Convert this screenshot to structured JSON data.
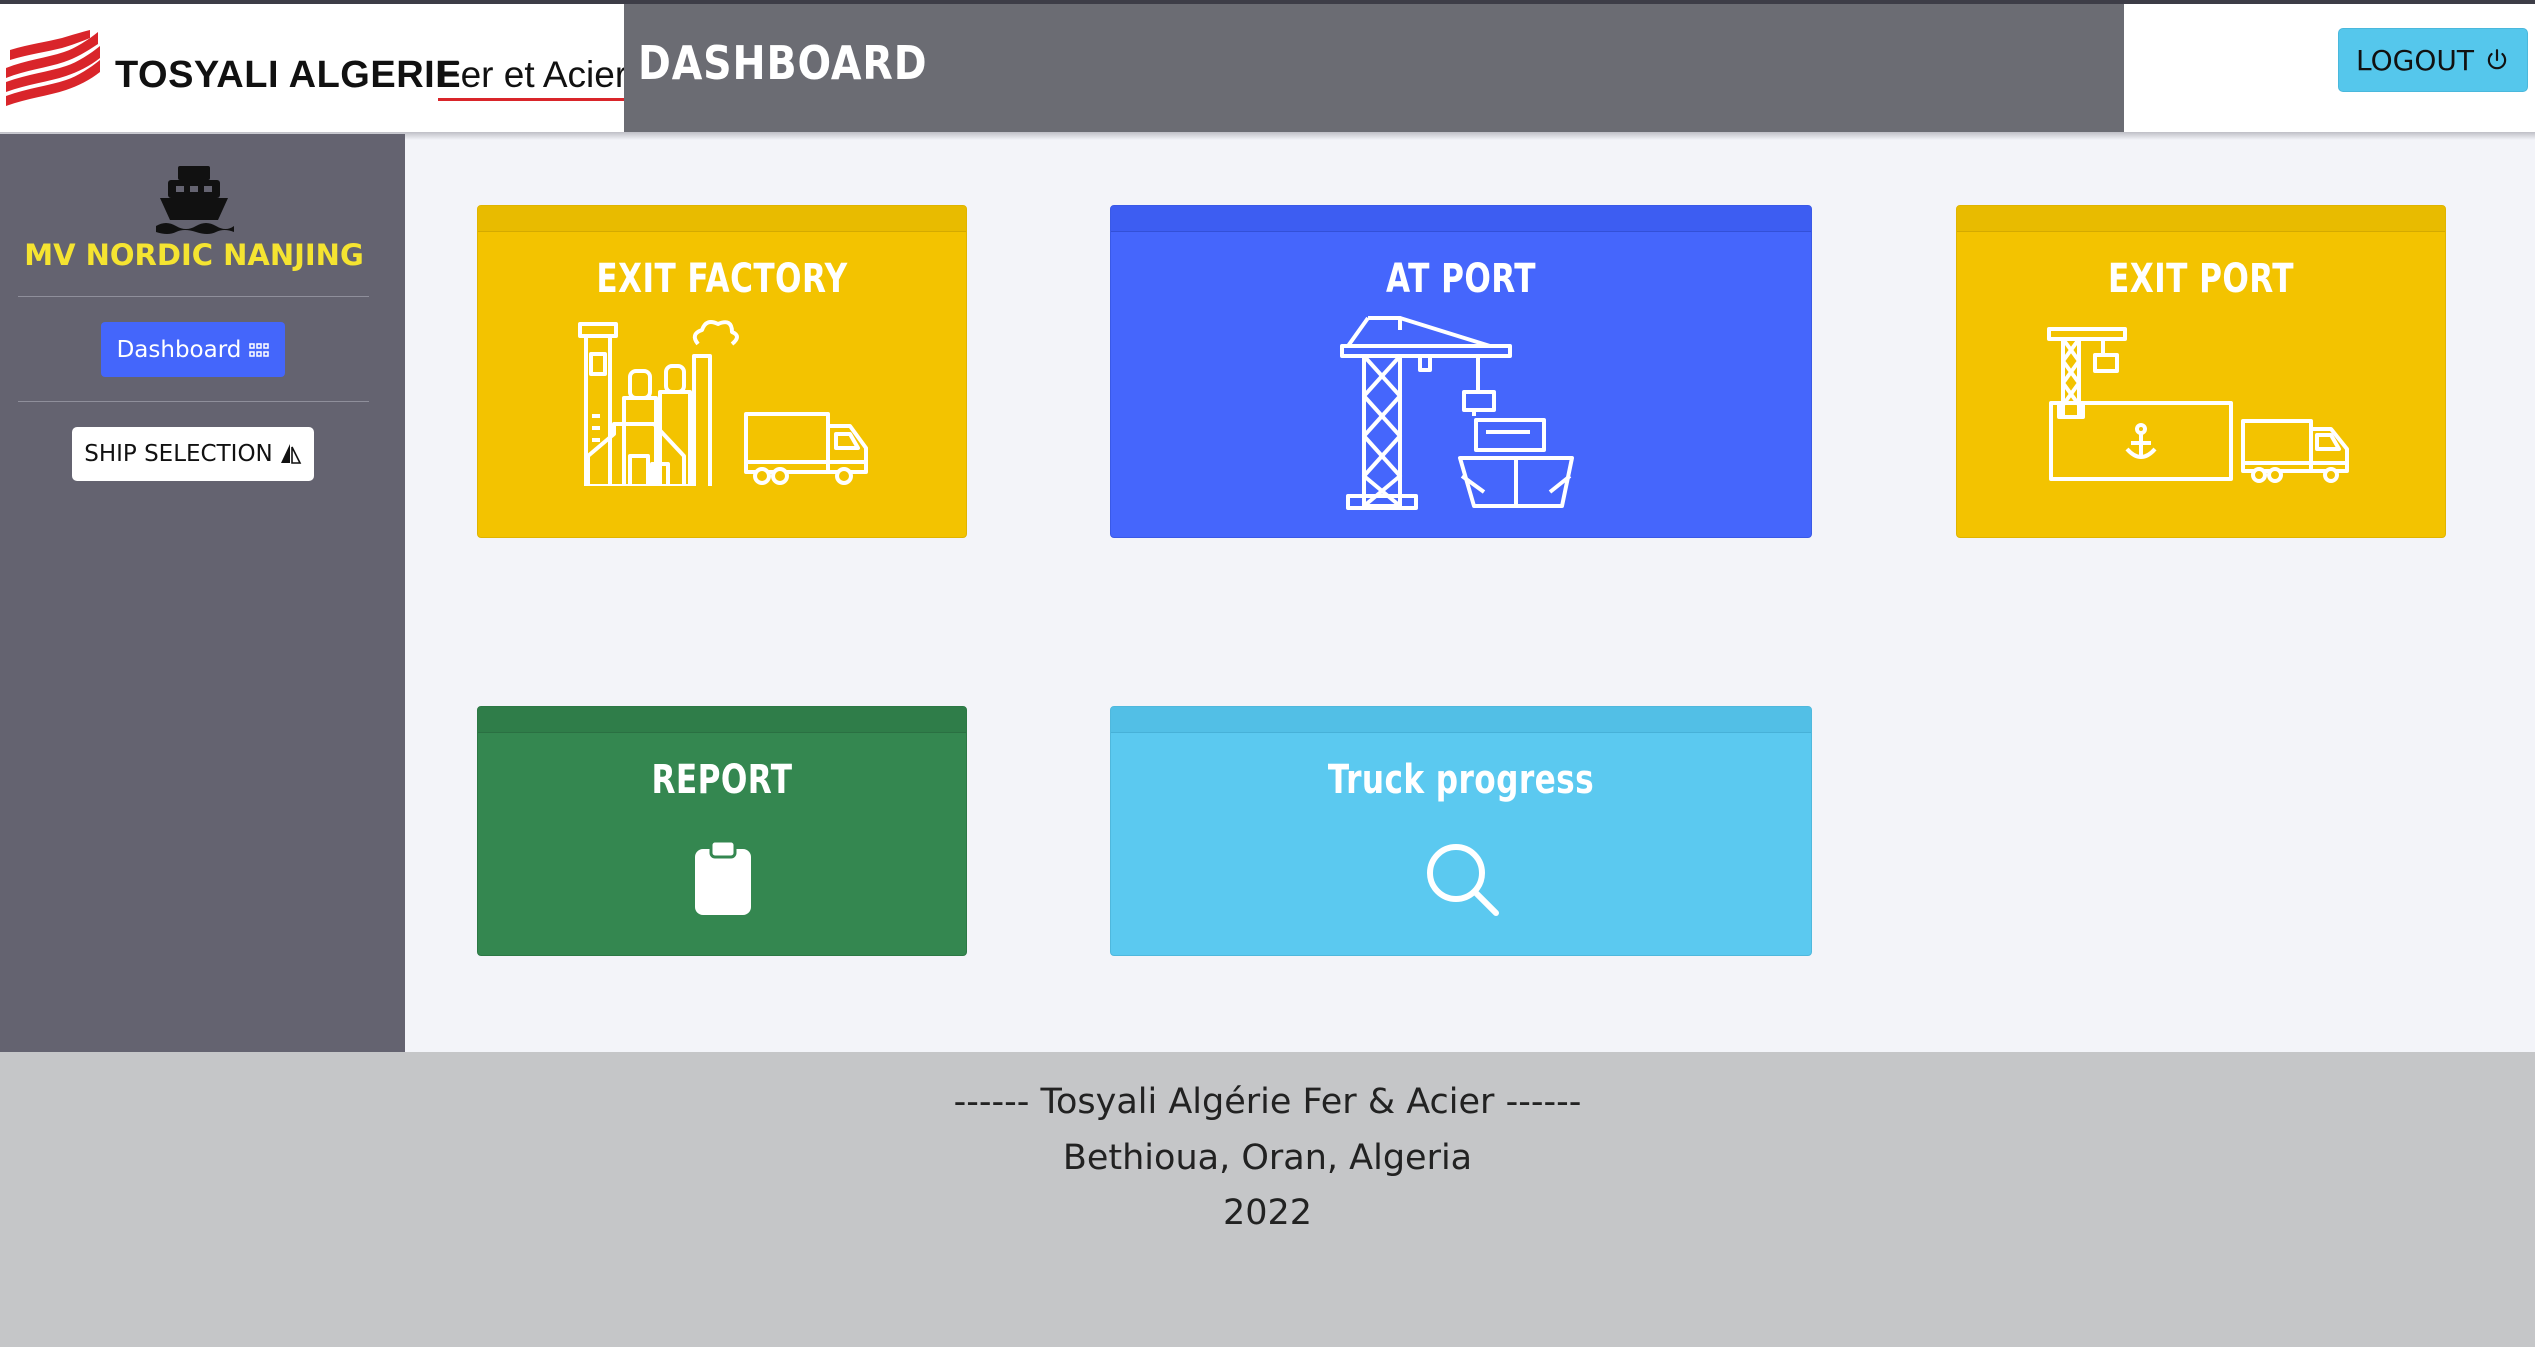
{
  "header": {
    "brand_name": "TOSYALI ALGERIE",
    "brand_sub": "Fer et Acier",
    "title": "DASHBOARD",
    "logout_label": "LOGOUT"
  },
  "sidebar": {
    "ship_name": "MV NORDIC NANJING",
    "dashboard_label": "Dashboard",
    "ship_selection_label": "SHIP SELECTION"
  },
  "cards": {
    "exit_factory": {
      "label": "EXIT FACTORY",
      "color": "#f3c300"
    },
    "at_port": {
      "label": "AT PORT",
      "color": "#4566fc"
    },
    "exit_port": {
      "label": "EXIT PORT",
      "color": "#f3c300"
    },
    "report": {
      "label": "REPORT",
      "color": "#348750"
    },
    "truck_progress": {
      "label": "Truck progress",
      "color": "#5bc9f0"
    }
  },
  "icons": {
    "logout": "power-icon",
    "ship": "ship-icon",
    "dashboard": "grid-icon",
    "ship_selection": "sailboat-icon",
    "exit_factory": "factory-truck-icon",
    "at_port": "crane-ship-icon",
    "exit_port": "port-truck-icon",
    "report": "clipboard-icon",
    "truck_progress": "search-icon"
  },
  "footer": {
    "line1": "------ Tosyali Algérie Fer & Acier ------",
    "line2": "Bethioua, Oran, Algeria",
    "line3": "2022"
  }
}
